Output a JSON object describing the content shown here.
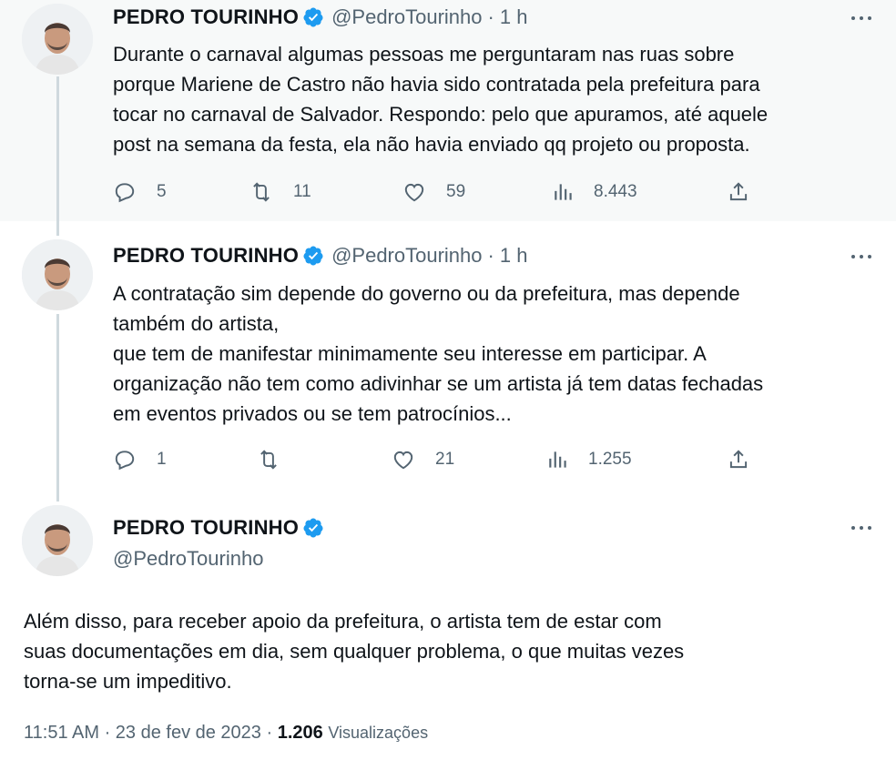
{
  "colors": {
    "verified": "#1d9bf0",
    "secondary_text": "#536471",
    "primary_text": "#0f1419",
    "highlight_bg": "#f7f9f9",
    "thread_line": "#cfd9de"
  },
  "tweets": [
    {
      "author_name": "PEDRO TOURINHO",
      "handle": "@PedroTourinho",
      "separator": "·",
      "time": "1 h",
      "text": "Durante o carnaval algumas pessoas me perguntaram nas ruas sobre\nporque Mariene de Castro não havia sido contratada pela prefeitura para\ntocar no carnaval de Salvador. Respondo: pelo que apuramos, até aquele\npost na semana da festa, ela não havia enviado qq projeto ou proposta.",
      "replies": "5",
      "retweets": "11",
      "likes": "59",
      "views": "8.443"
    },
    {
      "author_name": "PEDRO TOURINHO",
      "handle": "@PedroTourinho",
      "separator": "·",
      "time": "1 h",
      "text": "A contratação sim depende do governo ou da prefeitura, mas depende\ntambém do artista,\nque tem de manifestar minimamente seu interesse em participar. A\norganização não tem como adivinhar se um artista já tem datas fechadas\nem eventos privados ou se tem patrocínios...",
      "replies": "1",
      "retweets": "",
      "likes": "21",
      "views": "1.255"
    },
    {
      "author_name": "PEDRO TOURINHO",
      "handle": "@PedroTourinho",
      "text": "Além disso, para receber apoio da prefeitura, o artista tem de estar com\nsuas documentações em dia, sem qualquer problema, o que muitas vezes\ntorna-se um impeditivo.",
      "timestamp": "11:51 AM · 23 de fev de 2023 ·",
      "views_count": "1.206",
      "views_label": "Visualizações"
    }
  ],
  "icons": {
    "reply": "reply-icon",
    "retweet": "retweet-icon",
    "like": "heart-icon",
    "views": "analytics-icon",
    "share": "share-icon",
    "more": "more-icon",
    "verified": "verified-badge-icon"
  }
}
